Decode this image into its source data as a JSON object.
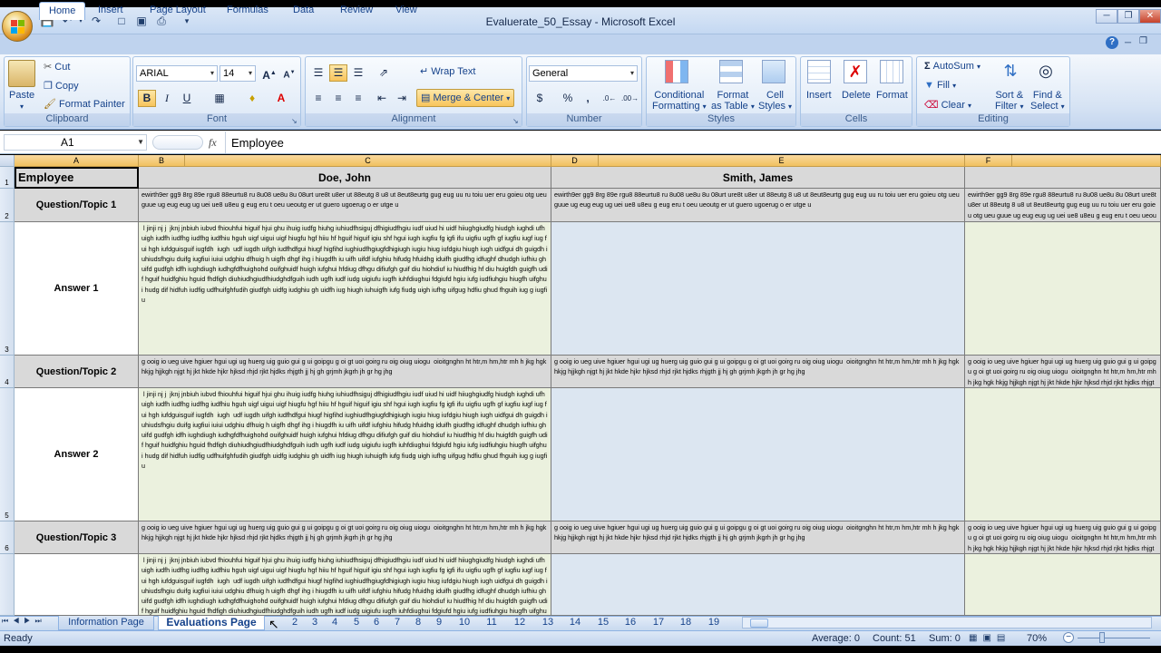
{
  "window": {
    "title": "Evaluerate_50_Essay - Microsoft Excel"
  },
  "tabs": [
    "Home",
    "Insert",
    "Page Layout",
    "Formulas",
    "Data",
    "Review",
    "View"
  ],
  "ribbon": {
    "clipboard": {
      "paste": "Paste",
      "cut": "Cut",
      "copy": "Copy",
      "format_painter": "Format Painter",
      "label": "Clipboard"
    },
    "font": {
      "name": "ARIAL",
      "size": "14",
      "bold": "B",
      "italic": "I",
      "underline": "U",
      "label": "Font"
    },
    "alignment": {
      "wrap": "Wrap Text",
      "merge": "Merge & Center",
      "label": "Alignment"
    },
    "number": {
      "format": "General",
      "currency": "$",
      "percent": "%",
      "comma": ",",
      "label": "Number"
    },
    "styles": {
      "conditional": "Conditional",
      "conditional2": "Formatting",
      "format_table": "Format",
      "format_table2": "as Table",
      "cell_styles": "Cell",
      "cell_styles2": "Styles",
      "label": "Styles"
    },
    "cells": {
      "insert": "Insert",
      "delete": "Delete",
      "format": "Format",
      "label": "Cells"
    },
    "editing": {
      "autosum": "AutoSum",
      "fill": "Fill",
      "clear": "Clear",
      "sort": "Sort &",
      "sort2": "Filter",
      "find": "Find &",
      "find2": "Select",
      "label": "Editing"
    }
  },
  "formula_bar": {
    "cell_ref": "A1",
    "fx": "fx",
    "content": "Employee"
  },
  "columns": [
    "A",
    "B",
    "C",
    "D",
    "E",
    "F"
  ],
  "rows": [
    "1",
    "2",
    "3",
    "4",
    "5",
    "6"
  ],
  "sheet": {
    "header_label": "Employee",
    "employees": [
      "Doe, John",
      "Smith, James"
    ],
    "q1_label": "Question/Topic 1",
    "a1_label": "Answer 1",
    "q2_label": "Question/Topic 2",
    "a2_label": "Answer 2",
    "q3_label": "Question/Topic 3",
    "q1_text": "ewirth9er gg9 8rg 89e rgu8 88eurtu8 ru 8u08 ue8u 8u 08urt ure8t u8er ut 88eutg 8 u8 ut 8eut8eurtg gug eug uu ru toiu uer eru goieu otg ueu guue ug eug eug ug uei ue8 u8eu g eug eru t oeu ueoutg er ut guero ugoerug o er utge u",
    "q2_text": "g ooig io ueg uive hgiuer hgui ugi ug huerg uig guio gui g ui goipgu g oi gt uoi goirg ru oig oiug uiogu  oioitgnghn ht htr,m hm,htr mh h jkg hgk hkjg hjjkgh njgt hj jkt hkde hjkr hjksd rhjd rjkt hjdks rhjgth jj hj gh grjmh jkgrh jh gr hg jhg",
    "answer_text": " l jinji nj j  jknj jnbiuh iubvd fhiouhfui higuif hjui ghu ihuig iudfg hiuhg iuhiudfhsiguj dfhigiudfhgiu iudf uiud hi uidf hiiughgiudfg hiudgh iughdi ufhuigh iudfh iudfhg iudfhg iudfhiu hguh uigf uigui uigf hiugfu hgf hiiu hf hguif higuif igiu shf hgui iugh iugfiu fg igfi ifu uigfiu ugfh gf iugfiu iugf iug fui hgh iufdguisguif iugfdh  iugh  udf iugdh uifgh iudfhdfgui hiugf higfihd iughiudfhgiugfdhigiugh iugiu hiug iufdgiu hiugh iugh uidfgui dh guigdh iuhiudsfhgiu duifg iugfiui iuiui udghiu dfhuig h uigfh dhgf ihg i hiugdfh iu uifh uifdf iufghiu hifudg hfuidhg iduifh giudfhg idfughf dhudgh iufhiu ghuifd gudfgh idfh iughdiugh iudhgfdfhuighohd ouifghuidf huigh iufghui hfdiug dfhgu difiufgh guif diu hiohdiuf iu hiudfhig hf diu huigfdh guigfh udif hguif huidfghiu hguid fhdfigh diuhiudhgiudfhiudghdfguih iudh ugfh iudf iudg uigiufu iugfh iuhfdiughui fdgiufd hgiu iufg iudfiuhgiu hiugfh uifghui hudg dif hidfuh iudfig udfhuifghfudih giudfgh uidfg iudghiu gh uidfh iug hiugh iuhuigfh iufg fiudg uigh iufhg uifgug hdfiu ghud fhguih iug g iugfiu"
  },
  "sheet_tabs": [
    "Information Page",
    "Evaluations Page",
    "2",
    "3",
    "4",
    "5",
    "6",
    "7",
    "8",
    "9",
    "10",
    "11",
    "12",
    "13",
    "14",
    "15",
    "16",
    "17",
    "18",
    "19"
  ],
  "status": {
    "ready": "Ready",
    "average": "Average: 0",
    "count": "Count: 51",
    "sum": "Sum: 0",
    "zoom": "70%"
  },
  "colors": {
    "gray_cell": "#d9d9d9",
    "green_cell": "#ebf1de",
    "blue_cell": "#dce6f1",
    "col_header": "#f1c15f"
  }
}
